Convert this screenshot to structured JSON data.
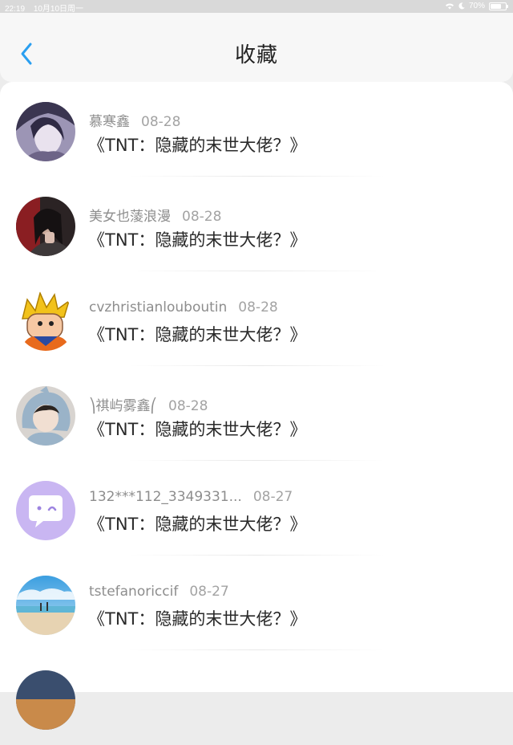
{
  "status_bar": {
    "time": "22:19",
    "date": "10月10日周一",
    "battery": "70%",
    "battery_level": 0.7,
    "icons": [
      "wifi-icon",
      "moon-icon",
      "battery-icon"
    ]
  },
  "header": {
    "title": "收藏",
    "back_icon": "chevron-left-icon",
    "accent": "#2a9ff0"
  },
  "items": [
    {
      "user": "慕寒鑫",
      "date": "08-28",
      "title": "《TNT：隐藏的末世大佬？》",
      "avatar": "anime-portrait-avatar"
    },
    {
      "user": "美女也蔆浪漫",
      "date": "08-28",
      "title": "《TNT：隐藏的末世大佬？》",
      "avatar": "dark-photo-avatar"
    },
    {
      "user": "cvzhristianlouboutin",
      "date": "08-28",
      "title": "《TNT：隐藏的末世大佬？》",
      "avatar": "cartoon-spiky-hair-avatar"
    },
    {
      "user": "⎞祺屿雾鑫⎛",
      "date": "08-28",
      "title": "《TNT：隐藏的末世大佬？》",
      "avatar": "shark-hood-avatar"
    },
    {
      "user": "132***112_3349331...",
      "date": "08-27",
      "title": "《TNT：隐藏的末世大佬？》",
      "avatar": "default-chat-bubble-avatar"
    },
    {
      "user": "tstefanoriccif",
      "date": "08-27",
      "title": "《TNT：隐藏的末世大佬？》",
      "avatar": "beach-sky-avatar"
    }
  ]
}
